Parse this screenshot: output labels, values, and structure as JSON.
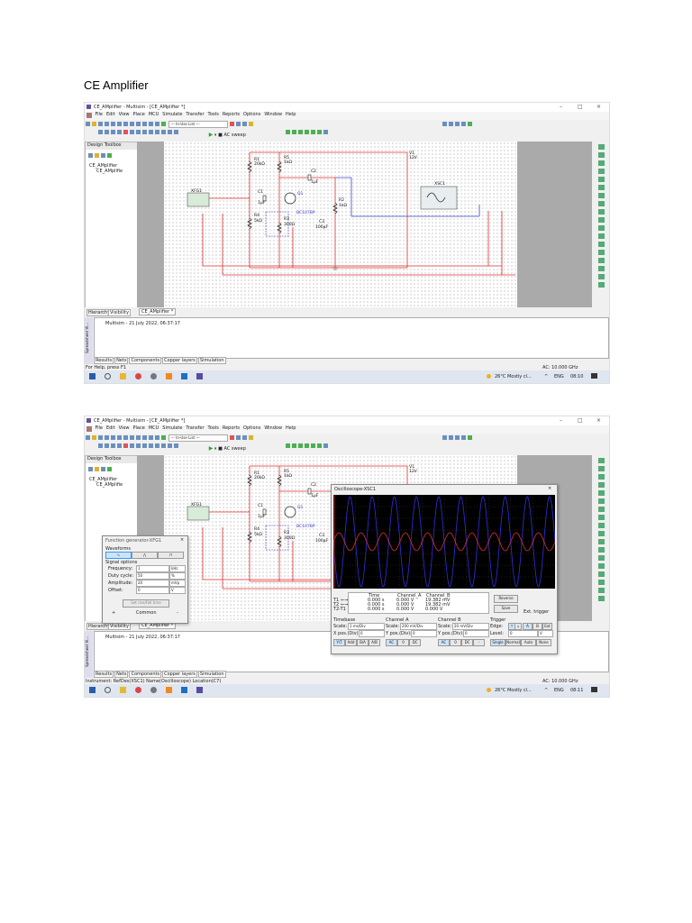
{
  "document": {
    "heading": "CE Amplifier"
  },
  "app": {
    "title1": "CE_AMplifier - Multisim - [CE_AMplifier *]",
    "title2": "CE_AMplifier - Multisim - [CE_AMplifier *]",
    "menu": [
      "File",
      "Edit",
      "View",
      "Place",
      "MCU",
      "Simulate",
      "Transfer",
      "Tools",
      "Reports",
      "Options",
      "Window",
      "Help"
    ],
    "inuse_list": "--- In-Use List ---",
    "analysis": "AC sweep",
    "toolbox_title": "Design Toolbox",
    "tree": [
      "CE_AMplifier",
      "CE_AMplifie"
    ],
    "tabs": [
      "Hierarchy",
      "Visibility"
    ],
    "doc_tab": "CE_AMplifier *",
    "sheet_line": "Multisim  -  21 July 2022, 06:37:17",
    "spreadsheet_label": "Spreadsheet Vi...",
    "bottom_tabs": [
      "Results",
      "Nets",
      "Components",
      "Copper layers",
      "Simulation"
    ],
    "status1": "For Help, press F1",
    "status2": "Instrument: RefDes(XSC1) Name(Oscilloscope) Location(C7)",
    "status_right": "AC: 10.000 GHz",
    "weather": "26°C  Mostly cl...",
    "lang": "ENG",
    "time1": "08:10",
    "time2": "08:11"
  },
  "schematic": {
    "labels": {
      "R1": "R1",
      "R1v": "20kΩ",
      "R5": "R5",
      "R5v": "1kΩ",
      "V1": "V1",
      "V1v": "12V",
      "C2": "C2",
      "C2v": "1µF",
      "C1": "C1",
      "C1v": "1µF",
      "Q1": "Q1",
      "R2": "R2",
      "R2v": "1kΩ",
      "R4": "R4",
      "R4v": "5kΩ",
      "Q1part": "BC107BP",
      "R3": "R3",
      "R3v": "300Ω",
      "C3": "C3",
      "C3v": "100µF",
      "XFG1": "XFG1",
      "XSC1": "XSC1"
    },
    "colors": {
      "wire": "#e03030",
      "probe": "#4040d0",
      "component": "#1a1a1a"
    }
  },
  "function_generator": {
    "title": "Function generator-XFG1",
    "waveforms_label": "Waveforms",
    "signal_options": "Signal options",
    "rows": [
      {
        "label": "Frequency:",
        "value": "1",
        "unit": "kHz"
      },
      {
        "label": "Duty cycle:",
        "value": "50",
        "unit": "%"
      },
      {
        "label": "Amplitude:",
        "value": "20",
        "unit": "mVp"
      },
      {
        "label": "Offset:",
        "value": "0",
        "unit": "V"
      }
    ],
    "set_rise": "Set rise/Fall time",
    "plus": "+",
    "common": "Common",
    "minus": "-"
  },
  "oscilloscope": {
    "title": "Oscilloscope-XSC1",
    "headers": [
      "Time",
      "Channel_A",
      "Channel_B"
    ],
    "rows": [
      {
        "label": "T1",
        "time": "0.000 s",
        "a": "0.000 V",
        "b": "19.382 mV"
      },
      {
        "label": "T2",
        "time": "0.000 s",
        "a": "0.000 V",
        "b": "19.382 mV"
      },
      {
        "label": "T2-T1",
        "time": "0.000 s",
        "a": "0.000 V",
        "b": "0.000 V"
      }
    ],
    "reverse": "Reverse",
    "save": "Save",
    "ext_trigger": "Ext. trigger",
    "timebase": {
      "title": "Timebase",
      "scale": "1 ms/Div",
      "xpos": "0",
      "buttons": [
        "Y/T",
        "Add",
        "B/A",
        "A/B"
      ]
    },
    "channel_a": {
      "title": "Channel A",
      "scale": "200 mV/Div",
      "ypos": "0",
      "buttons": [
        "AC",
        "0",
        "DC"
      ]
    },
    "channel_b": {
      "title": "Channel B",
      "scale": "20 mV/Div",
      "ypos": "0",
      "buttons": [
        "AC",
        "0",
        "DC",
        "-"
      ]
    },
    "trigger": {
      "title": "Trigger",
      "edge_label": "Edge:",
      "level_label": "Level:",
      "level": "0",
      "unit": "V",
      "sources": [
        "A",
        "B",
        "Ext"
      ],
      "modes": [
        "Single",
        "Normal",
        "Auto",
        "None"
      ]
    },
    "scale_label": "Scale:",
    "xpos_label": "X pos.(Div):",
    "ypos_label": "Y pos.(Div):",
    "trace_colors": {
      "a": "#e03030",
      "b": "#3030e0"
    }
  }
}
